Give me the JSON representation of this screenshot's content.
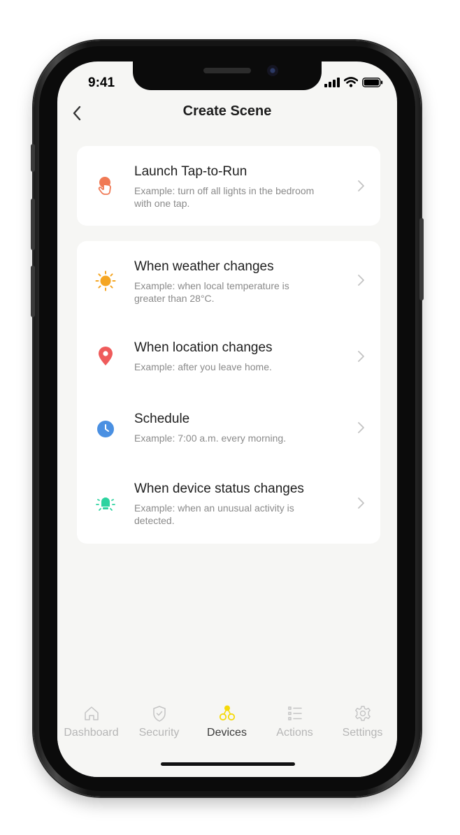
{
  "status_bar": {
    "time": "9:41"
  },
  "nav": {
    "title": "Create Scene"
  },
  "tap_to_run": {
    "title": "Launch Tap-to-Run",
    "desc": "Example: turn off all lights in the bedroom with one tap.",
    "icon": "tap-hand-icon",
    "color": "#f07a55"
  },
  "conditions": [
    {
      "title": "When weather changes",
      "desc": "Example: when local temperature is greater than 28°C.",
      "icon": "sun-icon",
      "color": "#f5a623"
    },
    {
      "title": "When location changes",
      "desc": "Example: after you leave home.",
      "icon": "location-pin-icon",
      "color": "#ef5b5b"
    },
    {
      "title": "Schedule",
      "desc": "Example: 7:00 a.m. every morning.",
      "icon": "clock-icon",
      "color": "#4a90e2"
    },
    {
      "title": "When device status changes",
      "desc": "Example: when an unusual activity is detected.",
      "icon": "device-bulb-icon",
      "color": "#2ed3a0"
    }
  ],
  "tabs": [
    {
      "label": "Dashboard",
      "icon": "home-icon",
      "active": false
    },
    {
      "label": "Security",
      "icon": "shield-icon",
      "active": false
    },
    {
      "label": "Devices",
      "icon": "devices-icon",
      "active": true
    },
    {
      "label": "Actions",
      "icon": "list-icon",
      "active": false
    },
    {
      "label": "Settings",
      "icon": "gear-icon",
      "active": false
    }
  ],
  "colors": {
    "accent": "#f5d90a",
    "inactive": "#b6b6b6",
    "background": "#f6f6f4"
  }
}
